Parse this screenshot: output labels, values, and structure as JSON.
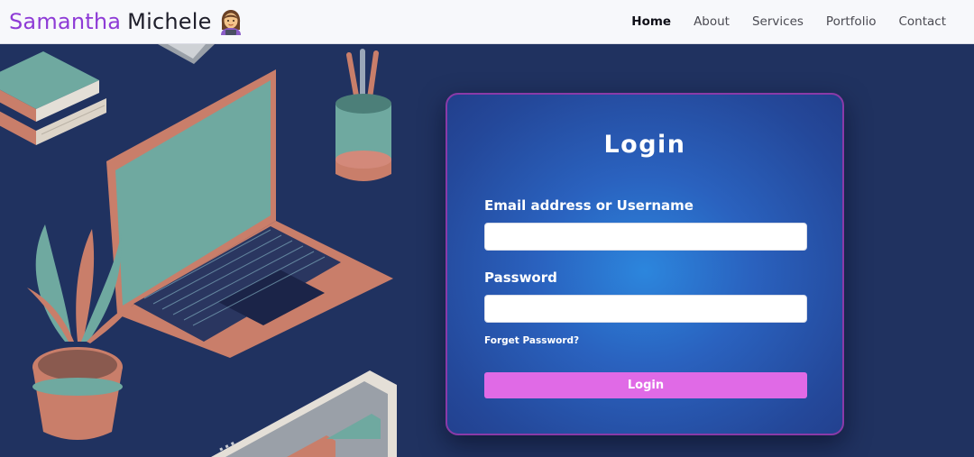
{
  "brand": {
    "first_name": "Samantha",
    "last_name": "Michele",
    "emoji_icon": "woman-technologist-icon",
    "first_color": "#8e3bd6"
  },
  "nav": {
    "items": [
      {
        "label": "Home",
        "active": true
      },
      {
        "label": "About",
        "active": false
      },
      {
        "label": "Services",
        "active": false
      },
      {
        "label": "Portfolio",
        "active": false
      },
      {
        "label": "Contact",
        "active": false
      }
    ]
  },
  "login": {
    "title": "Login",
    "email_label": "Email address or Username",
    "email_value": "",
    "password_label": "Password",
    "password_value": "",
    "forget_label": "Forget Password?",
    "button_label": "Login",
    "button_color": "#e06ae6",
    "border_color": "#8a3aa8"
  },
  "colors": {
    "background": "#203260",
    "navbar": "#f7f8fb"
  }
}
